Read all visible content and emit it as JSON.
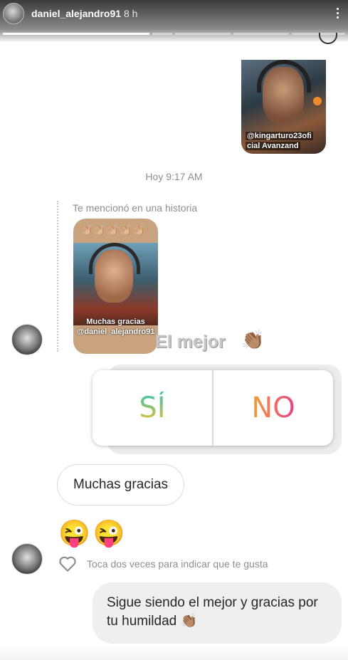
{
  "header": {
    "username": "daniel_alejandro91",
    "time": "8 h"
  },
  "sent_story": {
    "caption_line1": "@kingarturo23ofi",
    "caption_line2": "cial Avanzand"
  },
  "timestamp": "Hoy 9:17 AM",
  "mention": {
    "label": "Te mencionó en una historia",
    "claps": "👏🏼👏🏼👏🏼👏🏼👏🏼",
    "caption_line1": "Muchas gracias",
    "caption_line2": "@daniel_alejandro91"
  },
  "story_overlay": {
    "text": "El mejor",
    "emoji": "👏🏽"
  },
  "poll": {
    "yes_label": "SÍ",
    "no_label": "NO"
  },
  "messages": {
    "incoming_text": "Muchas gracias",
    "incoming_emojis": "😜😜",
    "like_hint": "Toca dos veces para indicar que te gusta",
    "outgoing_text": "Sigue siendo el mejor y gracias por tu humildad",
    "outgoing_emoji": "👏🏽"
  },
  "icons": [
    "more-icon",
    "heart-icon",
    "avatar"
  ]
}
